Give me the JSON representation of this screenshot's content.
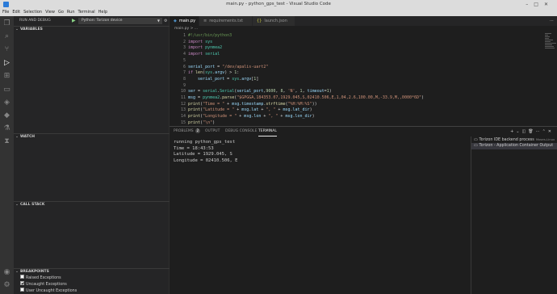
{
  "window": {
    "title": "main.py - python_gps_test - Visual Studio Code"
  },
  "menu": [
    "File",
    "Edit",
    "Selection",
    "View",
    "Go",
    "Run",
    "Terminal",
    "Help"
  ],
  "activity": [
    "files-icon",
    "search-icon",
    "source-control-icon",
    "run-debug-icon",
    "extensions-icon",
    "remote-explorer-icon",
    "docker-icon",
    "torizon-icon",
    "testing-icon",
    "timeline-icon"
  ],
  "sidebar": {
    "title": "RUN AND DEBUG",
    "config": "Python: Torizon device",
    "sections": {
      "variables": "VARIABLES",
      "watch": "WATCH",
      "callstack": "CALL STACK",
      "breakpoints": "BREAKPOINTS"
    },
    "breakpoints": [
      {
        "label": "Raised Exceptions",
        "checked": false
      },
      {
        "label": "Uncaught Exceptions",
        "checked": true
      },
      {
        "label": "User Uncaught Exceptions",
        "checked": false
      }
    ]
  },
  "tabs": [
    {
      "label": "main.py",
      "active": true
    },
    {
      "label": "requirements.txt",
      "active": false
    },
    {
      "label": "launch.json",
      "active": false
    }
  ],
  "breadcrumb": "main.py > ...",
  "code": [
    {
      "n": "1",
      "parts": [
        [
          "#!/usr/bin/python3",
          "#6a9955"
        ]
      ]
    },
    {
      "n": "2",
      "parts": [
        [
          "import",
          "#c586c0"
        ],
        [
          " sys",
          "#4ec9b0"
        ]
      ]
    },
    {
      "n": "3",
      "parts": [
        [
          "import",
          "#c586c0"
        ],
        [
          " pynmea2",
          "#4ec9b0"
        ]
      ]
    },
    {
      "n": "4",
      "parts": [
        [
          "import",
          "#c586c0"
        ],
        [
          " serial",
          "#4ec9b0"
        ]
      ]
    },
    {
      "n": "5",
      "parts": []
    },
    {
      "n": "6",
      "parts": [
        [
          "serial_port",
          "#9cdcfe"
        ],
        [
          " = ",
          "#d4d4d4"
        ],
        [
          "\"/dev/apalis-uart2\"",
          "#ce9178"
        ]
      ]
    },
    {
      "n": "7",
      "parts": [
        [
          "if",
          "#c586c0"
        ],
        [
          " ",
          "#d4d4d4"
        ],
        [
          "len",
          "#dcdcaa"
        ],
        [
          "(",
          "#d4d4d4"
        ],
        [
          "sys",
          "#4ec9b0"
        ],
        [
          ".",
          "#d4d4d4"
        ],
        [
          "argv",
          "#9cdcfe"
        ],
        [
          ") > ",
          "#d4d4d4"
        ],
        [
          "1",
          "#b5cea8"
        ],
        [
          ":",
          "#d4d4d4"
        ]
      ]
    },
    {
      "n": "8",
      "parts": [
        [
          "    serial_port",
          "#9cdcfe"
        ],
        [
          " = ",
          "#d4d4d4"
        ],
        [
          "sys",
          "#4ec9b0"
        ],
        [
          ".",
          "#d4d4d4"
        ],
        [
          "argv",
          "#9cdcfe"
        ],
        [
          "[",
          "#d4d4d4"
        ],
        [
          "1",
          "#b5cea8"
        ],
        [
          "]",
          "#d4d4d4"
        ]
      ]
    },
    {
      "n": "9",
      "parts": []
    },
    {
      "n": "10",
      "parts": [
        [
          "ser",
          "#9cdcfe"
        ],
        [
          " = ",
          "#d4d4d4"
        ],
        [
          "serial",
          "#4ec9b0"
        ],
        [
          ".",
          "#d4d4d4"
        ],
        [
          "Serial",
          "#4ec9b0"
        ],
        [
          "(",
          "#d4d4d4"
        ],
        [
          "serial_port",
          "#9cdcfe"
        ],
        [
          ",",
          "#d4d4d4"
        ],
        [
          "9600",
          "#b5cea8"
        ],
        [
          ", ",
          "#d4d4d4"
        ],
        [
          "8",
          "#b5cea8"
        ],
        [
          ", ",
          "#d4d4d4"
        ],
        [
          "'N'",
          "#ce9178"
        ],
        [
          ", ",
          "#d4d4d4"
        ],
        [
          "1",
          "#b5cea8"
        ],
        [
          ", ",
          "#d4d4d4"
        ],
        [
          "timeout",
          "#9cdcfe"
        ],
        [
          "=",
          "#d4d4d4"
        ],
        [
          "1",
          "#b5cea8"
        ],
        [
          ")",
          "#d4d4d4"
        ]
      ]
    },
    {
      "n": "11",
      "parts": [
        [
          "msg",
          "#9cdcfe"
        ],
        [
          " = ",
          "#d4d4d4"
        ],
        [
          "pynmea2",
          "#4ec9b0"
        ],
        [
          ".",
          "#d4d4d4"
        ],
        [
          "parse",
          "#dcdcaa"
        ],
        [
          "(",
          "#d4d4d4"
        ],
        [
          "\"$GPGGA,184353.07,1929.045,S,02410.506,E,1,04,2.6,100.00,M,-33.9,M,,0000*6D\"",
          "#ce9178"
        ],
        [
          ")",
          "#d4d4d4"
        ]
      ]
    },
    {
      "n": "12",
      "parts": [
        [
          "print",
          "#dcdcaa"
        ],
        [
          "(",
          "#d4d4d4"
        ],
        [
          "\"Time = \"",
          "#ce9178"
        ],
        [
          " + ",
          "#d4d4d4"
        ],
        [
          "msg",
          "#9cdcfe"
        ],
        [
          ".",
          "#d4d4d4"
        ],
        [
          "timestamp",
          "#9cdcfe"
        ],
        [
          ".",
          "#d4d4d4"
        ],
        [
          "strftime",
          "#dcdcaa"
        ],
        [
          "(",
          "#d4d4d4"
        ],
        [
          "\"%H:%M:%S\"",
          "#ce9178"
        ],
        [
          "))",
          "#d4d4d4"
        ]
      ]
    },
    {
      "n": "13",
      "parts": [
        [
          "print",
          "#dcdcaa"
        ],
        [
          "(",
          "#d4d4d4"
        ],
        [
          "\"Latitude = \"",
          "#ce9178"
        ],
        [
          " + ",
          "#d4d4d4"
        ],
        [
          "msg",
          "#9cdcfe"
        ],
        [
          ".",
          "#d4d4d4"
        ],
        [
          "lat",
          "#9cdcfe"
        ],
        [
          " + ",
          "#d4d4d4"
        ],
        [
          "\", \"",
          "#ce9178"
        ],
        [
          " + ",
          "#d4d4d4"
        ],
        [
          "msg",
          "#9cdcfe"
        ],
        [
          ".",
          "#d4d4d4"
        ],
        [
          "lat_dir",
          "#9cdcfe"
        ],
        [
          ")",
          "#d4d4d4"
        ]
      ]
    },
    {
      "n": "14",
      "parts": [
        [
          "print",
          "#dcdcaa"
        ],
        [
          "(",
          "#d4d4d4"
        ],
        [
          "\"Longitude = \"",
          "#ce9178"
        ],
        [
          " + ",
          "#d4d4d4"
        ],
        [
          "msg",
          "#9cdcfe"
        ],
        [
          ".",
          "#d4d4d4"
        ],
        [
          "lon",
          "#9cdcfe"
        ],
        [
          " + ",
          "#d4d4d4"
        ],
        [
          "\", \"",
          "#ce9178"
        ],
        [
          " + ",
          "#d4d4d4"
        ],
        [
          "msg",
          "#9cdcfe"
        ],
        [
          ".",
          "#d4d4d4"
        ],
        [
          "lon_dir",
          "#9cdcfe"
        ],
        [
          ")",
          "#d4d4d4"
        ]
      ]
    },
    {
      "n": "15",
      "parts": [
        [
          "print",
          "#dcdcaa"
        ],
        [
          "(",
          "#d4d4d4"
        ],
        [
          "\"\\n\"",
          "#ce9178"
        ],
        [
          ")",
          "#d4d4d4"
        ]
      ]
    }
  ],
  "panel": {
    "tabs": [
      {
        "label": "PROBLEMS",
        "badge": "2",
        "active": false
      },
      {
        "label": "OUTPUT",
        "active": false
      },
      {
        "label": "DEBUG CONSOLE",
        "active": false
      },
      {
        "label": "TERMINAL",
        "active": true
      }
    ],
    "terminal": [
      "running python_gps_test",
      "Time = 18:43:53",
      "Latitude = 1929.045, S",
      "Longitude = 02410.506, E"
    ],
    "terminals": [
      {
        "label": "Torizon IDE backend process",
        "desc": "Moses-Linux",
        "selected": false
      },
      {
        "label": "Torizon - Application Container Output",
        "desc": "",
        "selected": true
      }
    ]
  }
}
